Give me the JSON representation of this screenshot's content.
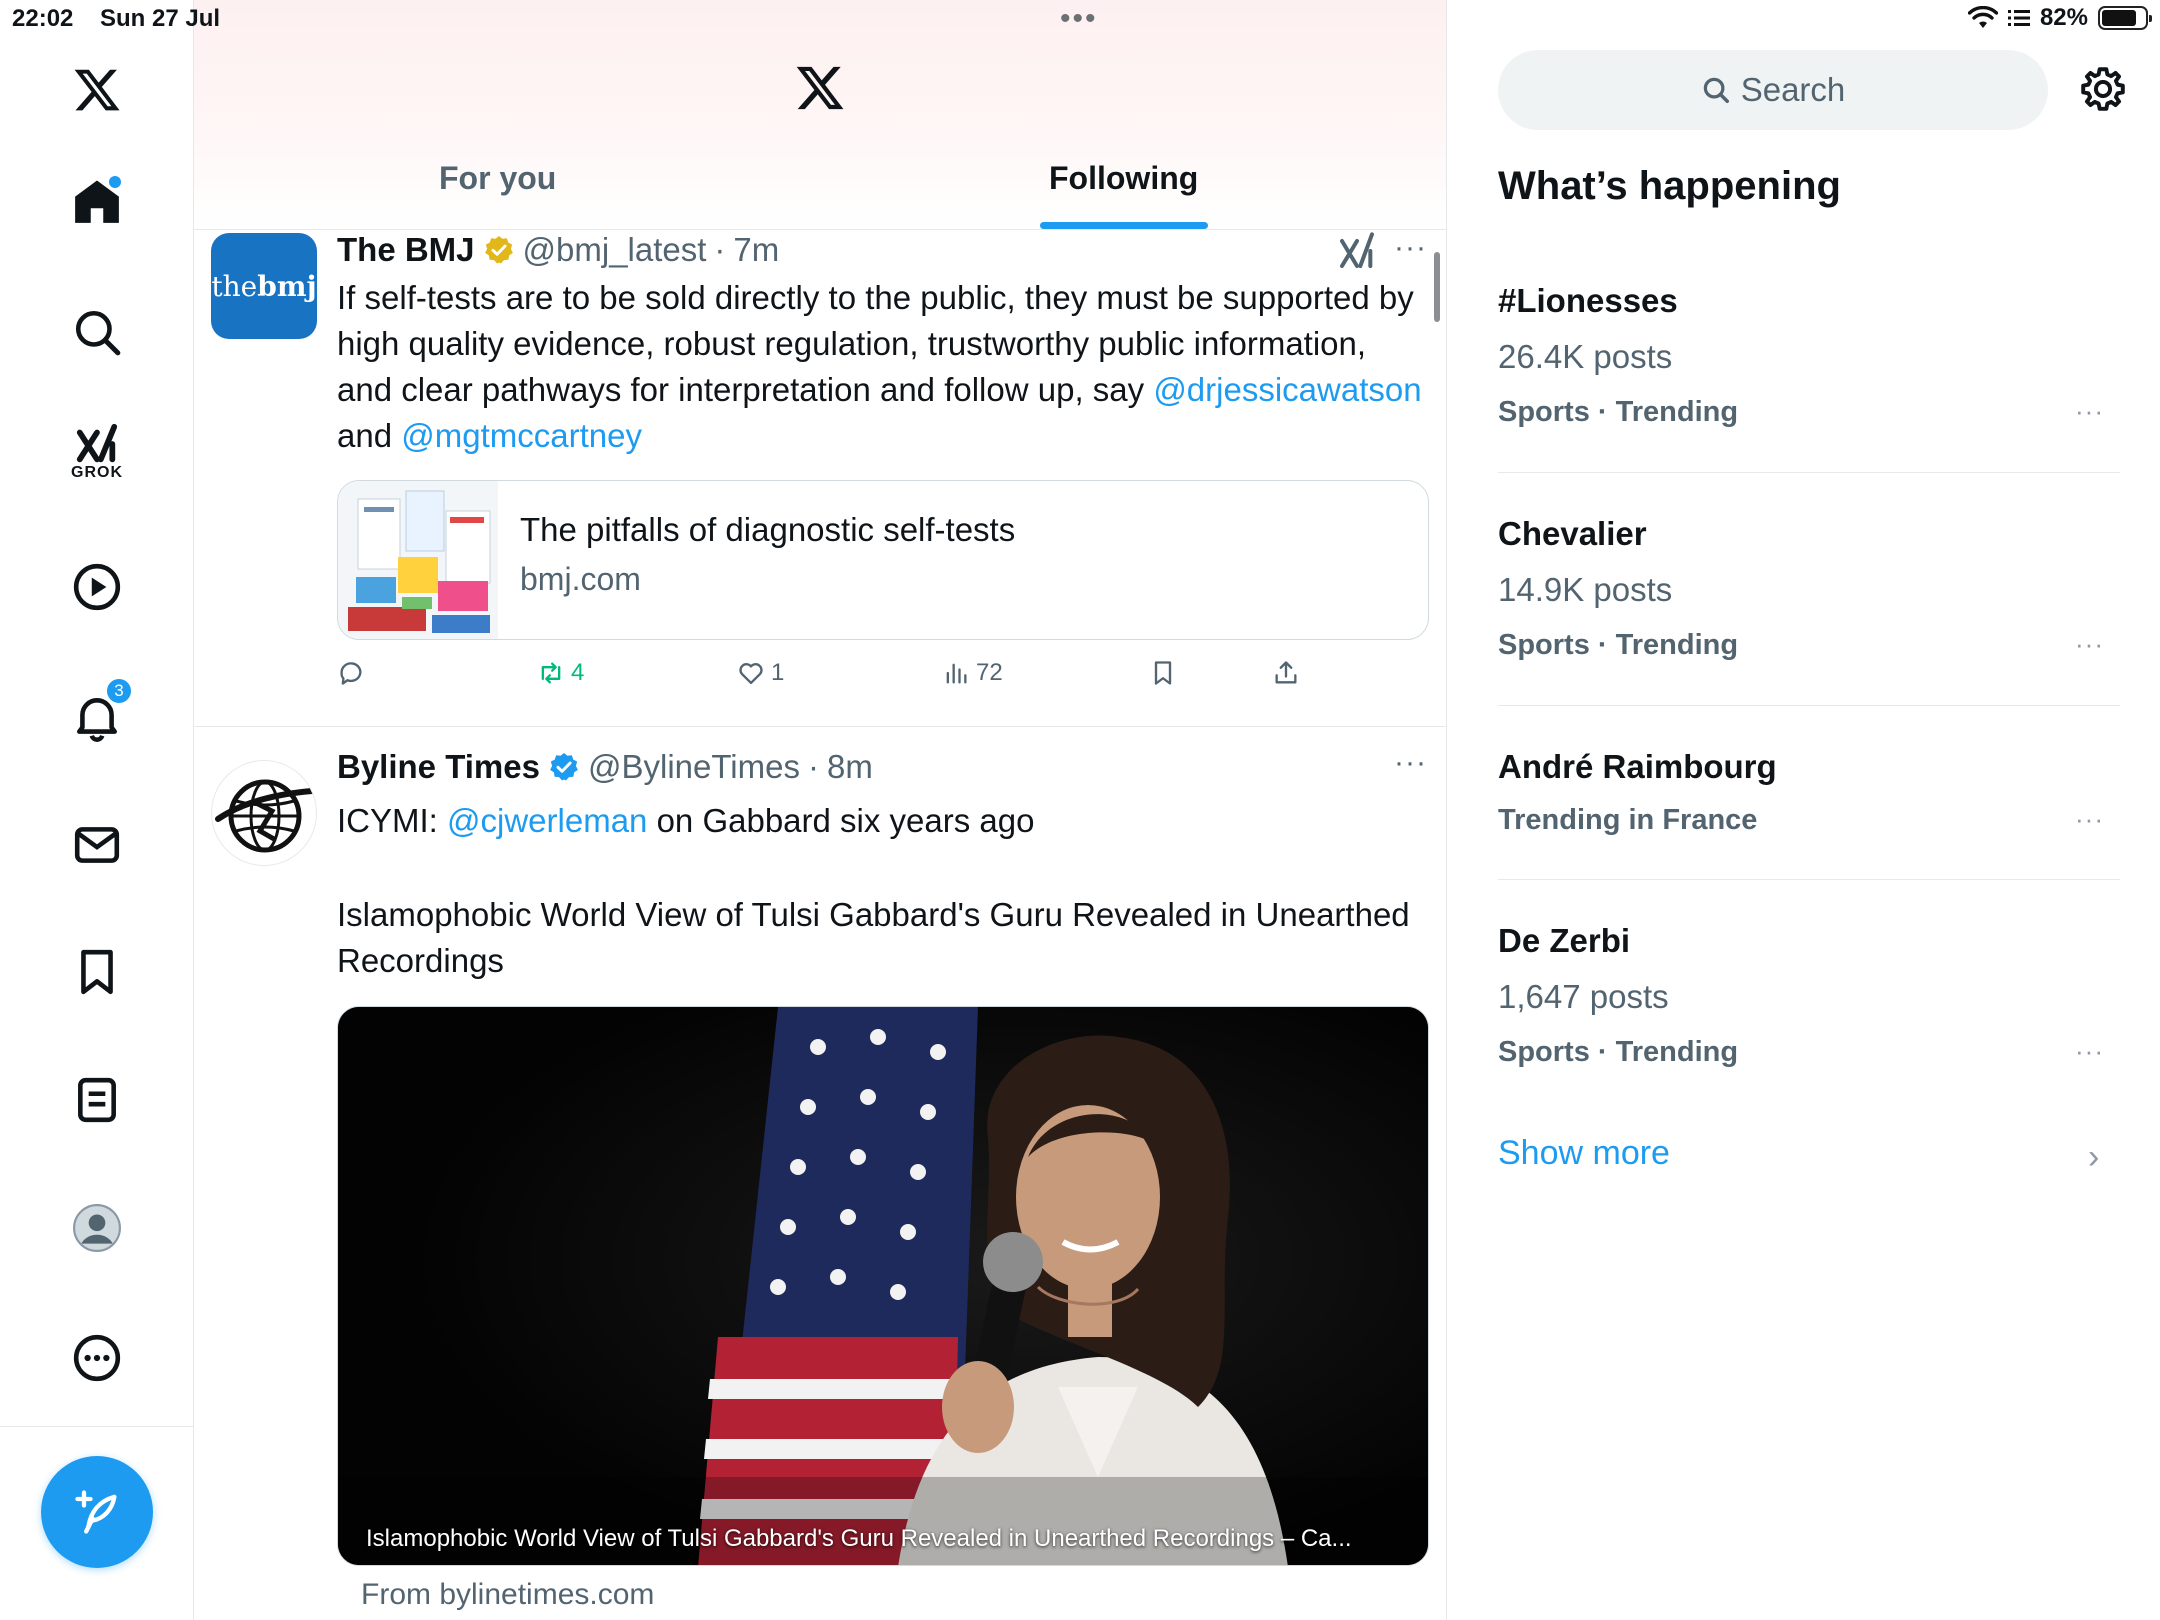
{
  "status_bar": {
    "time": "22:02",
    "date": "Sun 27 Jul",
    "battery": "82%"
  },
  "nav": {
    "items": [
      "home",
      "explore",
      "grok",
      "video",
      "notifications",
      "messages",
      "bookmarks",
      "lists",
      "profile",
      "more"
    ],
    "grok_label": "GROK",
    "notifications_badge": "3"
  },
  "header": {
    "tabs": [
      {
        "label": "For you",
        "active": false
      },
      {
        "label": "Following",
        "active": true
      }
    ]
  },
  "tweets": [
    {
      "author": "The BMJ",
      "handle": "@bmj_latest",
      "sep": "·",
      "time": "7m",
      "avatar_text_light": "the",
      "avatar_text_bold": "bmj",
      "text_parts": {
        "main": "If self-tests are to be sold directly to the public, they must be supported by high quality evidence, robust regulation, trustworthy public information, and clear pathways for interpretation and follow up, say ",
        "mention1": "@drjessicawatson",
        "and": " and ",
        "mention2": "@mgtmccartney"
      },
      "card": {
        "title": "The pitfalls of diagnostic self-tests",
        "domain": "bmj.com"
      },
      "stats": {
        "reposts": "4",
        "likes": "1",
        "views": "72"
      }
    },
    {
      "author": "Byline Times",
      "handle": "@BylineTimes",
      "sep": "·",
      "time": "8m",
      "text_parts": {
        "prefix": "ICYMI: ",
        "mention": "@cjwerleman",
        "suffix": " on Gabbard six years ago",
        "headline": "Islamophobic World View of Tulsi Gabbard's Guru Revealed in Unearthed Recordings"
      },
      "media_caption": "Islamophobic World View of Tulsi Gabbard's Guru Revealed in Unearthed Recordings – Ca...",
      "from": "From bylinetimes.com"
    }
  ],
  "sidebar": {
    "search_placeholder": "Search",
    "title": "What’s happening",
    "trends": [
      {
        "name": "#Lionesses",
        "posts": "26.4K posts",
        "category": "Sports · Trending"
      },
      {
        "name": "Chevalier",
        "posts": "14.9K posts",
        "category": "Sports · Trending"
      },
      {
        "name": "André Raimbourg",
        "posts": "",
        "category": "Trending in France"
      },
      {
        "name": "De Zerbi",
        "posts": "1,647 posts",
        "category": "Sports · Trending"
      }
    ],
    "show_more": "Show more",
    "more_glyph": "···"
  },
  "colors": {
    "accent": "#1d9bf0",
    "text": "#0f1419",
    "secondary": "#536471",
    "repost": "#00ba7c",
    "bmj_blue": "#1874c3"
  }
}
